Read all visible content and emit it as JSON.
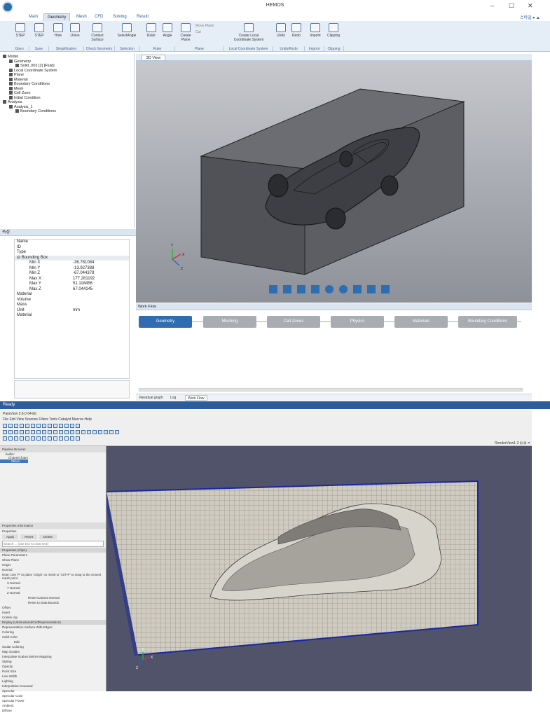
{
  "app": {
    "title": "HEMOS",
    "window_buttons": [
      "–",
      "☐",
      "✕"
    ],
    "right_tools": "스타일 ▾ ▲"
  },
  "ribbon_tabs": [
    "Main",
    "Geometry",
    "Mesh",
    "CFD",
    "Solving",
    "Result"
  ],
  "active_tab": "Geometry",
  "ribbon": {
    "buttons": [
      {
        "label": "STEP"
      },
      {
        "label": "STEP"
      },
      {
        "label": "Hole"
      },
      {
        "label": "Union"
      },
      {
        "label": "Contact Surface"
      },
      {
        "label": "SelectAngle"
      },
      {
        "label": "Ruler"
      },
      {
        "label": "Angle"
      },
      {
        "label": "Create Plane"
      },
      {
        "label": "Create Local Coordinate System"
      },
      {
        "label": "Undo"
      },
      {
        "label": "Redo"
      },
      {
        "label": "Imprint"
      },
      {
        "label": "Clipping"
      }
    ],
    "small_buttons": [
      "Move Plane",
      "Cut"
    ],
    "groups": [
      "Open",
      "Save",
      "Simplification",
      "Check Geometry",
      "Selection",
      "Ruler",
      "Plane",
      "Local Coordinate System",
      "Undo/Redo",
      "Imprint",
      "Clipping"
    ]
  },
  "tree": [
    {
      "label": "Model",
      "level": 0
    },
    {
      "label": "Geometry",
      "level": 1
    },
    {
      "label": "Solid_002 [2] [Fluid]",
      "level": 2
    },
    {
      "label": "Local Coordinate System",
      "level": 1
    },
    {
      "label": "Plane",
      "level": 1
    },
    {
      "label": "Material",
      "level": 1
    },
    {
      "label": "Boundary Conditions",
      "level": 1
    },
    {
      "label": "Mesh",
      "level": 1
    },
    {
      "label": "Cell Zone",
      "level": 1
    },
    {
      "label": "Initial Condition",
      "level": 1
    },
    {
      "label": "Analysis",
      "level": 0
    },
    {
      "label": "Analysis_1",
      "level": 1
    },
    {
      "label": "Boundary Conditions",
      "level": 2
    }
  ],
  "properties": {
    "header": "속성",
    "rows": [
      {
        "name": "Name",
        "value": "",
        "indent": 0
      },
      {
        "name": "ID",
        "value": "",
        "indent": 0
      },
      {
        "name": "Type",
        "value": "",
        "indent": 0
      },
      {
        "name": "⊟ Bounding Box",
        "value": "",
        "indent": 0,
        "section": true
      },
      {
        "name": "Min X",
        "value": "-36.781084",
        "indent": 1
      },
      {
        "name": "Min Y",
        "value": "-13.927388",
        "indent": 1
      },
      {
        "name": "Min Z",
        "value": "-67.044378",
        "indent": 1
      },
      {
        "name": "Max X",
        "value": "177.281192",
        "indent": 1
      },
      {
        "name": "Max Y",
        "value": "51.118456",
        "indent": 1
      },
      {
        "name": "Max Z",
        "value": "67.044145",
        "indent": 1
      },
      {
        "name": "Material",
        "value": "",
        "indent": 0
      },
      {
        "name": "Volume",
        "value": "",
        "indent": 0
      },
      {
        "name": "Mass",
        "value": "",
        "indent": 0
      },
      {
        "name": "Unit",
        "value": "mm",
        "indent": 0
      },
      {
        "name": "Material",
        "value": "",
        "indent": 0
      }
    ]
  },
  "view": {
    "tab": "3D View",
    "axes": {
      "x": "X",
      "y": "Y",
      "z": "Z"
    }
  },
  "workflow": {
    "header": "Work Flow",
    "steps": [
      "Geometry",
      "Meshing",
      "Cell Zones",
      "Physics",
      "Materials",
      "Boundary Conditions"
    ],
    "active_step": "Geometry"
  },
  "bottom_tabs": [
    "Residual graph",
    "Log",
    "Work Flow"
  ],
  "active_bottom_tab": "Work Flow",
  "status": "Ready",
  "paraview": {
    "title": "ParaView 5.6.0 64-bit",
    "menu": "File  Edit  View  Sources  Filters  Tools  Catalyst  Macros  Help",
    "pipeline_header": "Pipeline Browser",
    "pipeline_items": [
      "builtin:",
      "Channel.foam",
      "Slice1"
    ],
    "tabs": [
      "Properties",
      "Information"
    ],
    "render_label": "RenderView1  3 ⊟ ⊞ ✕",
    "axes": {
      "x": "X",
      "y": "Y",
      "z": "Z"
    },
    "labels": {
      "properties_panel": "Properties",
      "apply": "Apply",
      "reset": "Reset",
      "delete": "Delete",
      "search": "Search ... (use Esc to clear text)",
      "section_props": "Properties (Clip1)",
      "plane_params": "Plane Parameters",
      "show_plane": "Show Plane",
      "origin": "Origin",
      "normal": "Normal",
      "note": "Note: Use 'P' to place 'Origin' on mesh or 'Ctrl+P' to snap to the closest mesh point",
      "x_normal": "X Normal",
      "y_normal": "Y Normal",
      "z_normal": "Z Normal",
      "camera_normal": "Camera Normal",
      "reset_camera": "Reset Camera Normal",
      "reset_bounds": "Reset to Data Bounds",
      "offset": "Offset",
      "invert": "Invert",
      "crinkle": "Crinkle clip",
      "display_section": "Display (UnstructuredGridRepresentation)",
      "representation": "Representation",
      "surface_edges": "Surface With Edges",
      "coloring": "Coloring",
      "solid_color": "Solid Color",
      "edit": "Edit",
      "scalar_coloring": "Scalar Coloring",
      "map_scalars": "Map Scalars",
      "interpolate": "Interpolate Scalars Before Mapping",
      "styling": "Styling",
      "opacity": "Opacity",
      "point_size": "Point Size",
      "line_width": "Line Width",
      "lighting": "Lighting",
      "interpolation": "Interpolation",
      "gouraud": "Gouraud",
      "specular": "Specular",
      "specular_color": "Specular Color",
      "specular_power": "Specular Power",
      "ambient": "Ambient",
      "diffuse": "Diffuse"
    }
  }
}
